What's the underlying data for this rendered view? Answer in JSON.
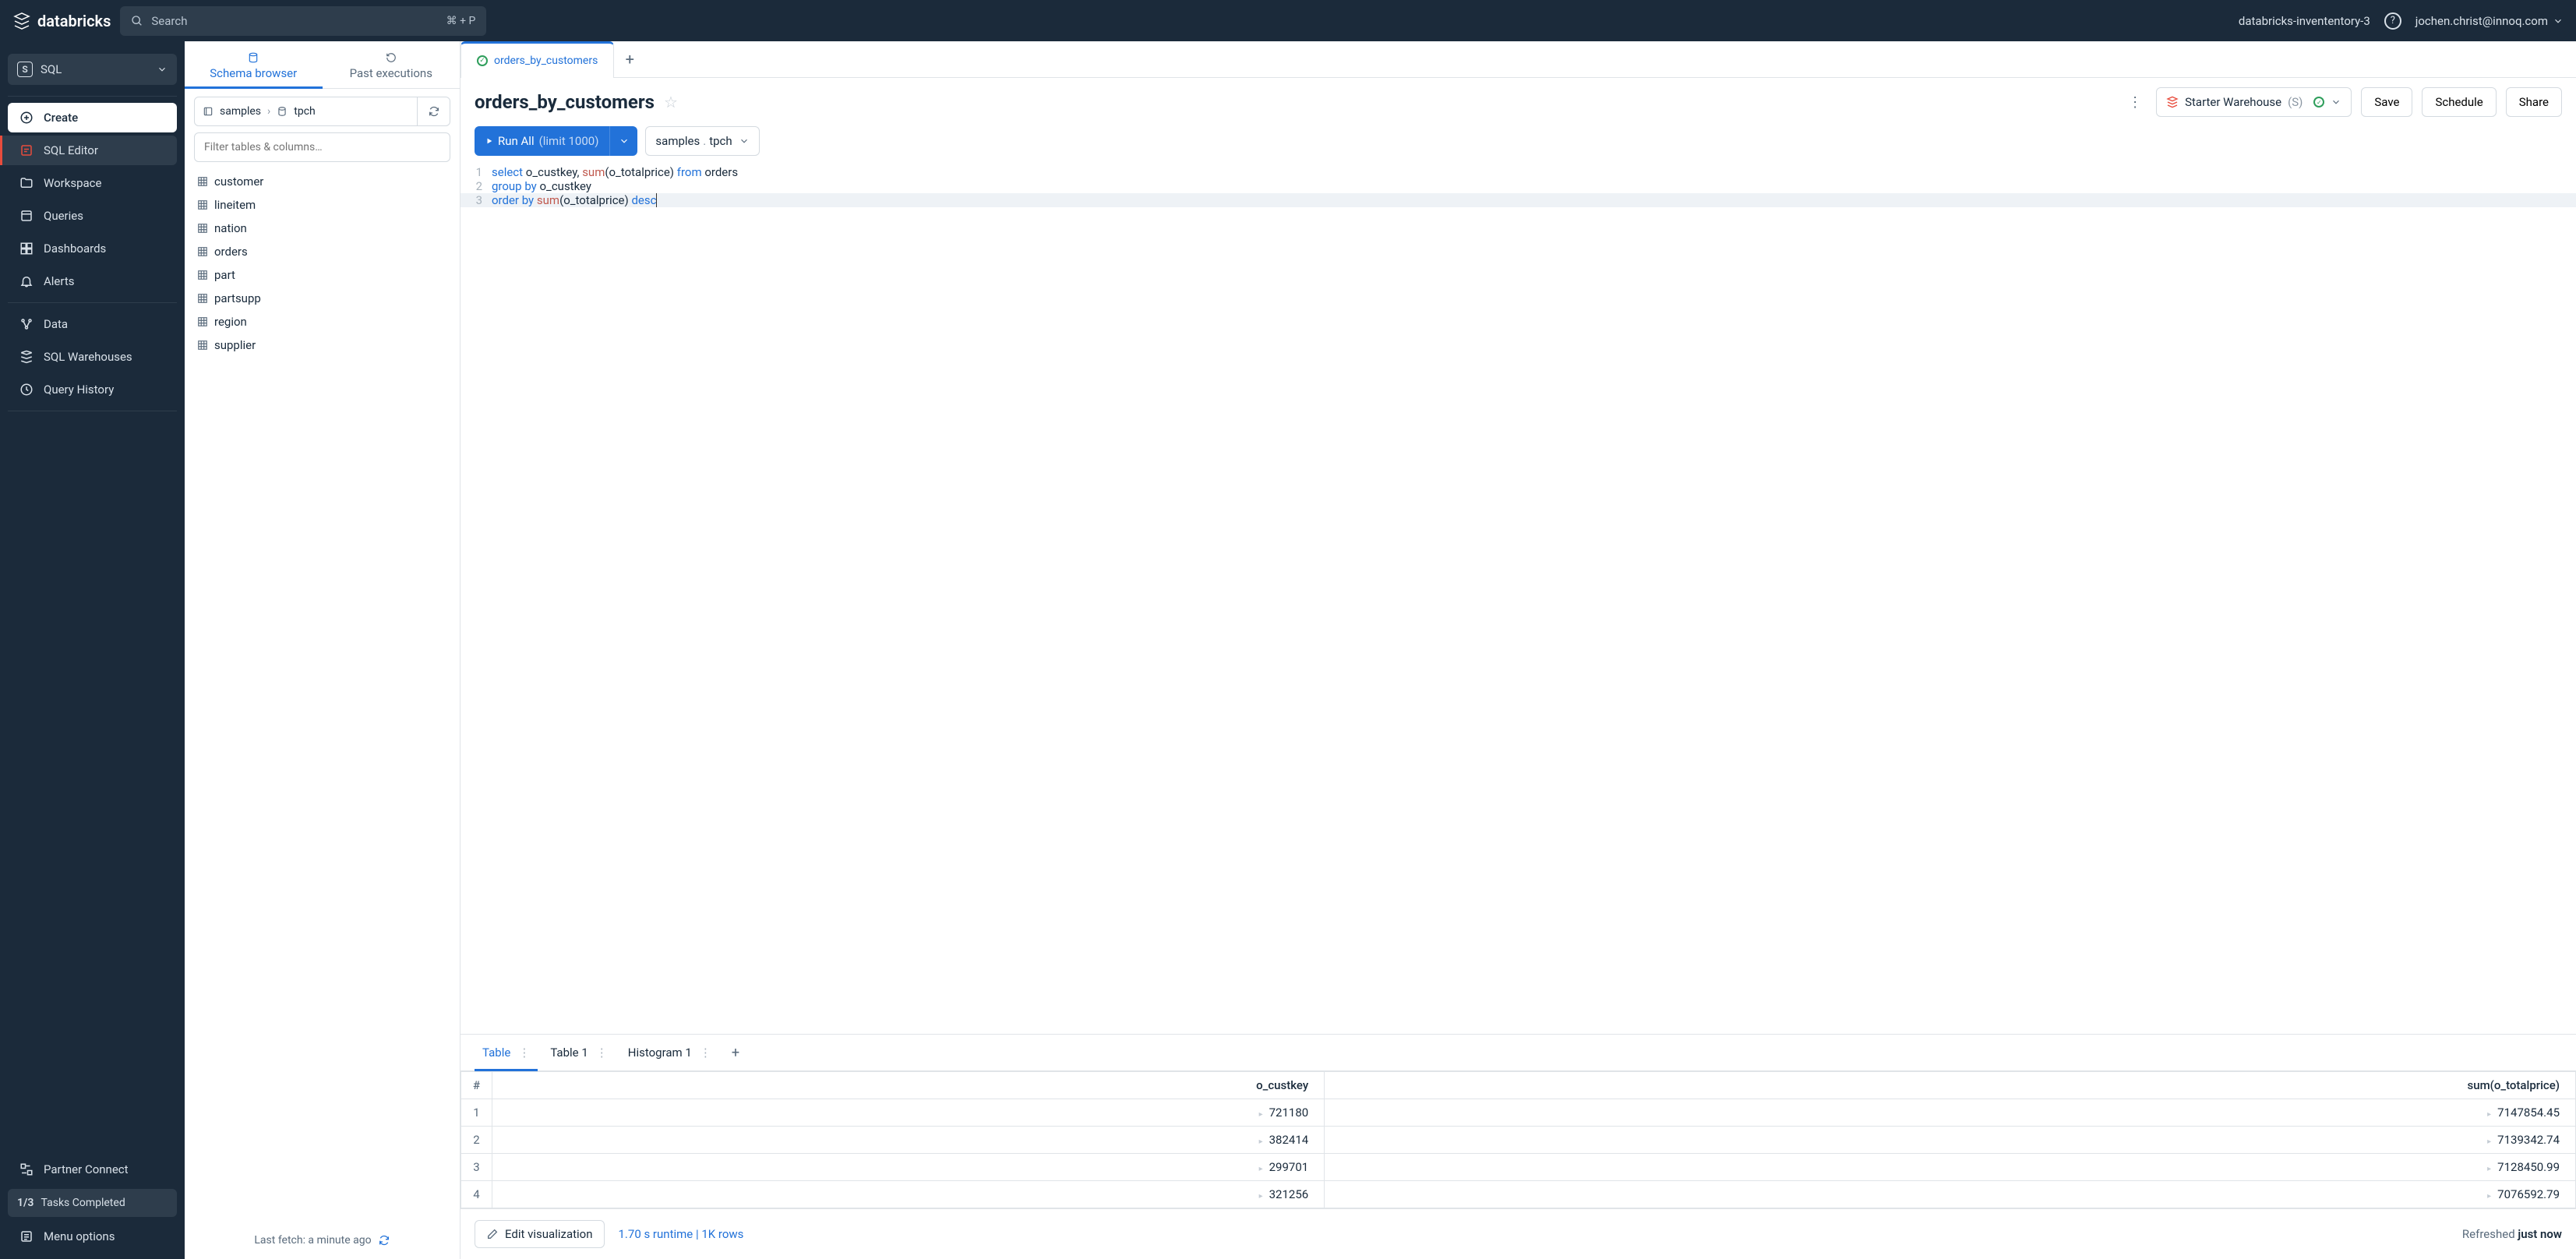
{
  "topbar": {
    "brand": "databricks",
    "search_placeholder": "Search",
    "search_shortcut": "⌘ + P",
    "workspace": "databricks-invententory-3",
    "user": "jochen.christ@innoq.com"
  },
  "sidebar": {
    "persona_label": "SQL",
    "create_label": "Create",
    "items": [
      {
        "label": "SQL Editor",
        "icon": "sql-editor",
        "active": true
      },
      {
        "label": "Workspace",
        "icon": "workspace"
      },
      {
        "label": "Queries",
        "icon": "queries"
      },
      {
        "label": "Dashboards",
        "icon": "dashboards"
      },
      {
        "label": "Alerts",
        "icon": "alerts"
      }
    ],
    "section2": [
      {
        "label": "Data",
        "icon": "data"
      },
      {
        "label": "SQL Warehouses",
        "icon": "warehouses"
      },
      {
        "label": "Query History",
        "icon": "history"
      }
    ],
    "footer": [
      {
        "label": "Partner Connect",
        "icon": "partner"
      }
    ],
    "tasks_fraction": "1/3",
    "tasks_label": "Tasks Completed",
    "menu_label": "Menu options"
  },
  "browser": {
    "tabs": {
      "schema": "Schema browser",
      "past": "Past executions"
    },
    "breadcrumbs": {
      "catalog": "samples",
      "schema": "tpch"
    },
    "filter_placeholder": "Filter tables & columns…",
    "tables": [
      "customer",
      "lineitem",
      "nation",
      "orders",
      "part",
      "partsupp",
      "region",
      "supplier"
    ],
    "last_fetch": "Last fetch: a minute ago"
  },
  "editor": {
    "tab_name": "orders_by_customers",
    "title": "orders_by_customers",
    "warehouse": {
      "name": "Starter Warehouse",
      "size": "(S)"
    },
    "buttons": {
      "save": "Save",
      "schedule": "Schedule",
      "share": "Share"
    },
    "run": {
      "label": "Run All",
      "limit": "(limit 1000)"
    },
    "schema_context": {
      "catalog": "samples",
      "sep": " . ",
      "schema": "tpch"
    },
    "code_lines": [
      {
        "n": "1",
        "tokens": [
          [
            "kw",
            "select"
          ],
          [
            "",
            " o_custkey, "
          ],
          [
            "fn",
            "sum"
          ],
          [
            "",
            "(o_totalprice) "
          ],
          [
            "kw",
            "from"
          ],
          [
            "",
            " orders"
          ]
        ]
      },
      {
        "n": "2",
        "tokens": [
          [
            "kw",
            "group by"
          ],
          [
            "",
            " o_custkey"
          ]
        ]
      },
      {
        "n": "3",
        "tokens": [
          [
            "kw",
            "order by"
          ],
          [
            "",
            " "
          ],
          [
            "fn",
            "sum"
          ],
          [
            "",
            "(o_totalprice) "
          ],
          [
            "kw",
            "desc"
          ]
        ]
      }
    ]
  },
  "results": {
    "tabs": [
      "Table",
      "Table 1",
      "Histogram 1"
    ],
    "columns": [
      "#",
      "o_custkey",
      "sum(o_totalprice)"
    ],
    "rows": [
      {
        "n": "1",
        "c1": "721180",
        "c2": "7147854.45"
      },
      {
        "n": "2",
        "c1": "382414",
        "c2": "7139342.74"
      },
      {
        "n": "3",
        "c1": "299701",
        "c2": "7128450.99"
      },
      {
        "n": "4",
        "c1": "321256",
        "c2": "7076592.79"
      }
    ],
    "edit_viz": "Edit visualization",
    "runtime": "1.70 s runtime  |  1K rows",
    "refreshed_prefix": "Refreshed ",
    "refreshed_value": "just now"
  }
}
